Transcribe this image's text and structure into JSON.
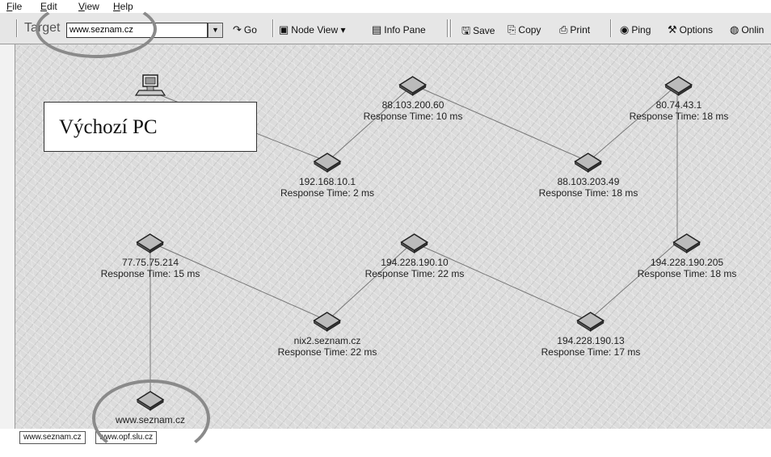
{
  "menu": [
    "File",
    "Edit",
    "View",
    "Help"
  ],
  "toolbar": {
    "target_label": "Target",
    "target_value": "www.seznam.cz",
    "go": "Go",
    "node_view": "Node View",
    "info_pane": "Info Pane",
    "save": "Save",
    "copy": "Copy",
    "print": "Print",
    "ping": "Ping",
    "options": "Options",
    "online": "Onlin"
  },
  "callout": "Výchozí PC",
  "nodes": [
    {
      "name": "",
      "response": ""
    },
    {
      "name": "192.168.10.1",
      "response": "Response Time: 2 ms"
    },
    {
      "name": "88.103.200.60",
      "response": "Response Time: 10 ms"
    },
    {
      "name": "88.103.203.49",
      "response": "Response Time: 18 ms"
    },
    {
      "name": "80.74.43.1",
      "response": "Response Time: 18 ms"
    },
    {
      "name": "194.228.190.205",
      "response": "Response Time: 18 ms"
    },
    {
      "name": "194.228.190.13",
      "response": "Response Time: 17 ms"
    },
    {
      "name": "194.228.190.10",
      "response": "Response Time: 22 ms"
    },
    {
      "name": "nix2.seznam.cz",
      "response": "Response Time: 22 ms"
    },
    {
      "name": "77.75.75.214",
      "response": "Response Time: 15 ms"
    },
    {
      "name": "www.seznam.cz",
      "response": ""
    }
  ],
  "tabs": [
    "www.seznam.cz",
    "www.opf.slu.cz"
  ],
  "colors": {
    "canvas": "#dcdcdc",
    "toolbar": "#e6e6e6",
    "annotation_ring": "#8a8a8a",
    "link": "#777777"
  }
}
